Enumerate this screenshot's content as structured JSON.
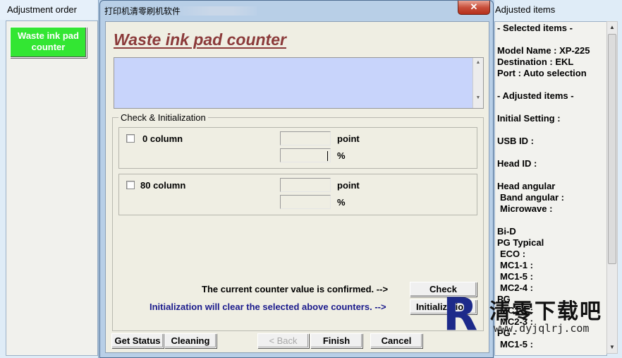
{
  "left_pane": {
    "header": "Adjustment order",
    "active_item": "Waste ink pad counter"
  },
  "dialog": {
    "title": "打印机清零刷机软件",
    "close_glyph": "✕",
    "main_title": "Waste ink pad counter",
    "group_label": "Check & Initialization",
    "columns": [
      {
        "label": "0 column",
        "point_unit": "point",
        "percent_unit": "%",
        "checked": false
      },
      {
        "label": "80 column",
        "point_unit": "point",
        "percent_unit": "%",
        "checked": false
      }
    ],
    "confirm_text": "The current counter value is confirmed. -->",
    "init_text": "Initialization will clear the selected above counters. -->",
    "init_text_color": "#1a1a8c",
    "check_button": "Check",
    "init_button": "Initialization",
    "get_status_button": "Get Status",
    "cleaning_button": "Cleaning",
    "back_button": "< Back",
    "finish_button": "Finish",
    "cancel_button": "Cancel"
  },
  "right_pane": {
    "header": "Adjusted items",
    "lines": [
      "- Selected items -",
      "Model Name : XP-225",
      "Destination : EKL",
      "Port : Auto selection",
      "- Adjusted items -",
      "Initial Setting :",
      "USB ID :",
      "Head ID :",
      "Head angular",
      " Band angular :",
      " Microwave :",
      "Bi-D",
      "PG Typical",
      " ECO    :",
      " MC1-1 :",
      " MC1-5 :",
      " MC2-4 :",
      "PG",
      " MC1-1 :",
      " MC2-3 :",
      "PG -",
      " MC1-5 :"
    ]
  },
  "watermark": {
    "logo_letter": "R",
    "site_name": "清零下载吧",
    "url": "www.dyjqlrj.com"
  }
}
